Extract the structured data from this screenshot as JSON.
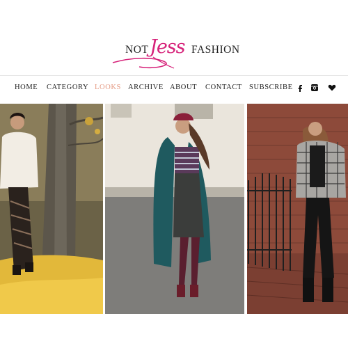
{
  "logo": {
    "not": "NOT",
    "script": "Jess",
    "fashion": "FASHION",
    "brand_color": "#d6237a"
  },
  "nav": {
    "items": [
      {
        "label": "HOME",
        "active": false
      },
      {
        "label": "CATEGORY",
        "active": false
      },
      {
        "label": "LOOKS",
        "active": true
      },
      {
        "label": "ARCHIVE",
        "active": false
      },
      {
        "label": "ABOUT",
        "active": false
      },
      {
        "label": "CONTACT",
        "active": false
      },
      {
        "label": "SUBSCRIBE",
        "active": false
      }
    ],
    "active_color": "#e59a83",
    "social_icons": [
      "facebook-icon",
      "instagram-icon",
      "heart-icon"
    ]
  },
  "gallery": {
    "photos": [
      {
        "name": "look-photo-1"
      },
      {
        "name": "look-photo-2"
      },
      {
        "name": "look-photo-3"
      }
    ]
  }
}
